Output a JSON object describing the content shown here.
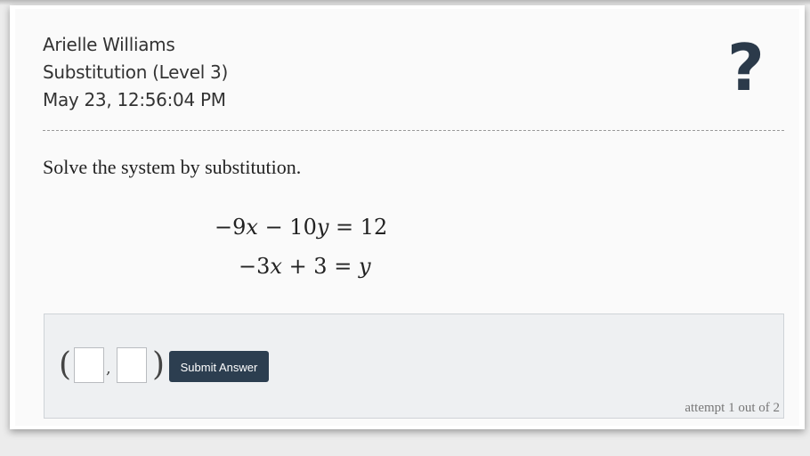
{
  "header": {
    "student_name": "Arielle Williams",
    "assignment": "Substitution (Level 3)",
    "timestamp": "May 23, 12:56:04 PM",
    "help_icon": "?"
  },
  "problem": {
    "prompt": "Solve the system by substitution.",
    "equation1": "−9x − 10y = 12",
    "equation2": "−3x + 3 = y"
  },
  "answer": {
    "open_paren": "(",
    "comma": ",",
    "close_paren": ")",
    "x_value": "",
    "y_value": "",
    "submit_label": "Submit Answer",
    "attempt_text": "attempt 1 out of 2"
  },
  "colors": {
    "accent": "#2c3e50",
    "answer_bg": "#eef0f2"
  }
}
